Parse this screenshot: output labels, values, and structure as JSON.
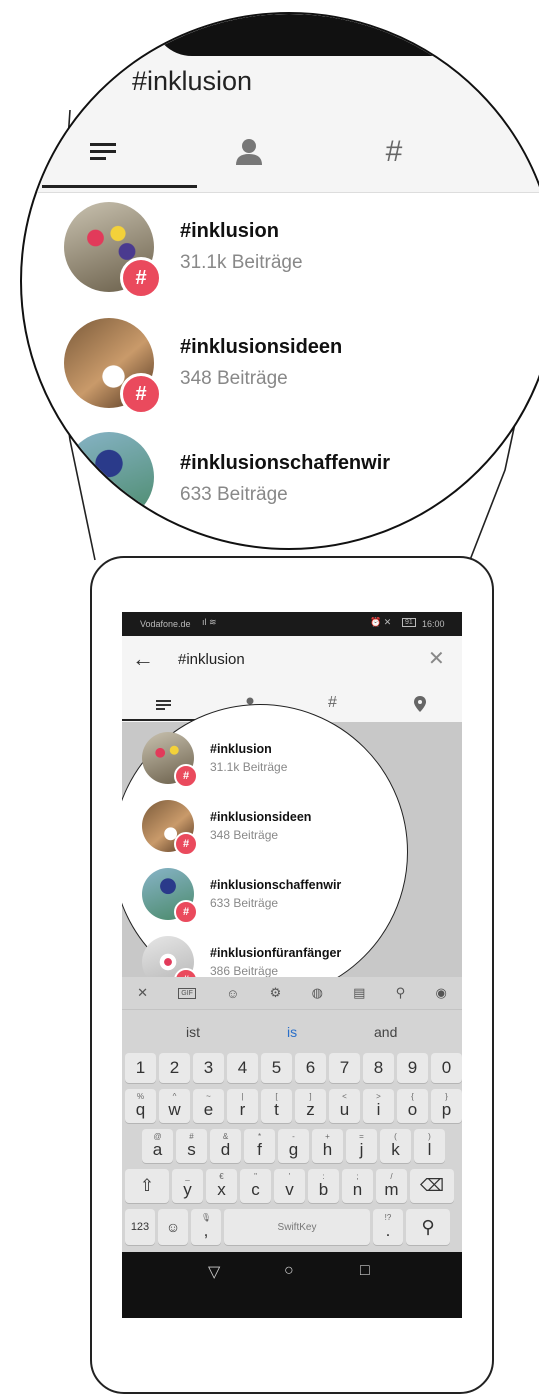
{
  "magnified": {
    "title": "#inklusion",
    "tabs": [
      "top",
      "accounts",
      "tags"
    ],
    "results": [
      {
        "name": "#inklusion",
        "posts": "31.1k Beiträge"
      },
      {
        "name": "#inklusionsideen",
        "posts": "348 Beiträge"
      },
      {
        "name": "#inklusionschaffenwir",
        "posts": "633 Beiträge"
      }
    ]
  },
  "status_bar": {
    "carrier": "Vodafone.de",
    "battery": "91",
    "time": "16:00"
  },
  "search": {
    "query": "#inklusion",
    "back_icon": "arrow-left-icon",
    "clear_icon": "close-icon"
  },
  "tabs": [
    {
      "icon": "top-icon",
      "active": true
    },
    {
      "icon": "account-icon",
      "active": false
    },
    {
      "icon": "hashtag-icon",
      "active": false
    },
    {
      "icon": "places-icon",
      "active": false
    }
  ],
  "results": [
    {
      "name": "#inklusion",
      "posts": "31.1k Beiträge"
    },
    {
      "name": "#inklusionsideen",
      "posts": "348 Beiträge"
    },
    {
      "name": "#inklusionschaffenwir",
      "posts": "633 Beiträge"
    },
    {
      "name": "#inklusionfüranfänger",
      "posts": "386 Beiträge"
    }
  ],
  "keyboard": {
    "suggestions": [
      "ist",
      "is",
      "and"
    ],
    "numbers": [
      "1",
      "2",
      "3",
      "4",
      "5",
      "6",
      "7",
      "8",
      "9",
      "0"
    ],
    "row1": [
      [
        "%",
        "q"
      ],
      [
        "^",
        "w"
      ],
      [
        "~",
        "e"
      ],
      [
        "|",
        "r"
      ],
      [
        "[",
        "t"
      ],
      [
        "]",
        "z"
      ],
      [
        "<",
        "u"
      ],
      [
        ">",
        "i"
      ],
      [
        "{",
        "o"
      ],
      [
        "}",
        "p"
      ]
    ],
    "row2": [
      [
        "@",
        "a"
      ],
      [
        "#",
        "s"
      ],
      [
        "&",
        "d"
      ],
      [
        "*",
        "f"
      ],
      [
        "-",
        "g"
      ],
      [
        "+",
        "h"
      ],
      [
        "=",
        "j"
      ],
      [
        "(",
        "k"
      ],
      [
        ")",
        "l"
      ]
    ],
    "row3": [
      [
        "_",
        "y"
      ],
      [
        "€",
        "x"
      ],
      [
        "\"",
        "c"
      ],
      [
        "'",
        "v"
      ],
      [
        ":",
        "b"
      ],
      [
        ";",
        "n"
      ],
      [
        "/",
        "m"
      ]
    ],
    "mode_key": "123",
    "space_label": "SwiftKey",
    "toolbar": [
      "close-icon",
      "gif-icon",
      "sticker-icon",
      "settings-icon",
      "palette-icon",
      "clipboard-icon",
      "pin-icon",
      "location-icon"
    ]
  },
  "nav": [
    "back-icon",
    "home-icon",
    "recents-icon"
  ],
  "colors": {
    "badge": "#ea4a5d",
    "accent": "#2a6fc9"
  }
}
